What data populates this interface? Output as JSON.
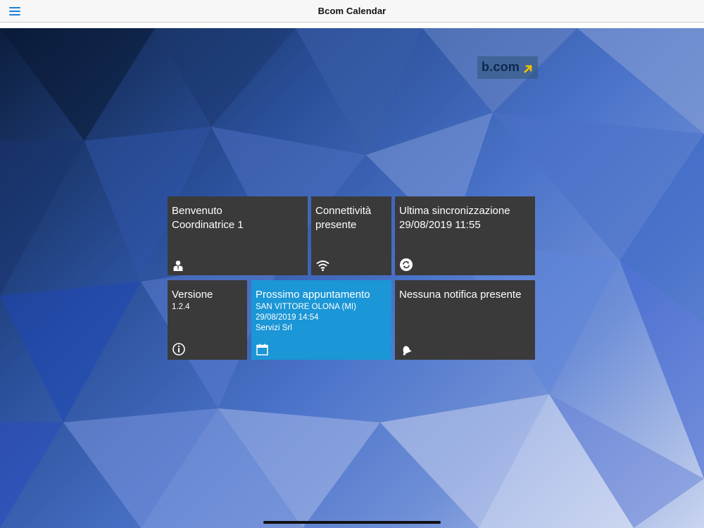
{
  "navbar": {
    "title": "Bcom Calendar",
    "menu_icon": "hamburger-menu-icon"
  },
  "logo": {
    "text": "b.com",
    "arrow_color": "#f2c200"
  },
  "colors": {
    "tile_dark": "#3a3a3a",
    "tile_accent": "#1b96d6",
    "nav_tint": "#1e7fd8"
  },
  "tiles": {
    "welcome": {
      "title": "Benvenuto\nCoordinatrice 1",
      "icon": "user-icon"
    },
    "connectivity": {
      "title": "Connettività\npresente",
      "icon": "wifi-icon"
    },
    "sync": {
      "title": "Ultima sincronizzazione\n29/08/2019 11:55",
      "icon": "sync-icon"
    },
    "version": {
      "title": "Versione",
      "value": "1.2.4",
      "icon": "info-icon"
    },
    "appointment": {
      "title": "Prossimo appuntamento",
      "location": "SAN VITTORE OLONA (MI)",
      "datetime": "29/08/2019 14:54",
      "company": "Servizi Srl",
      "icon": "calendar-icon"
    },
    "notifications": {
      "title": "Nessuna notifica presente",
      "icon": "bell-icon"
    }
  }
}
